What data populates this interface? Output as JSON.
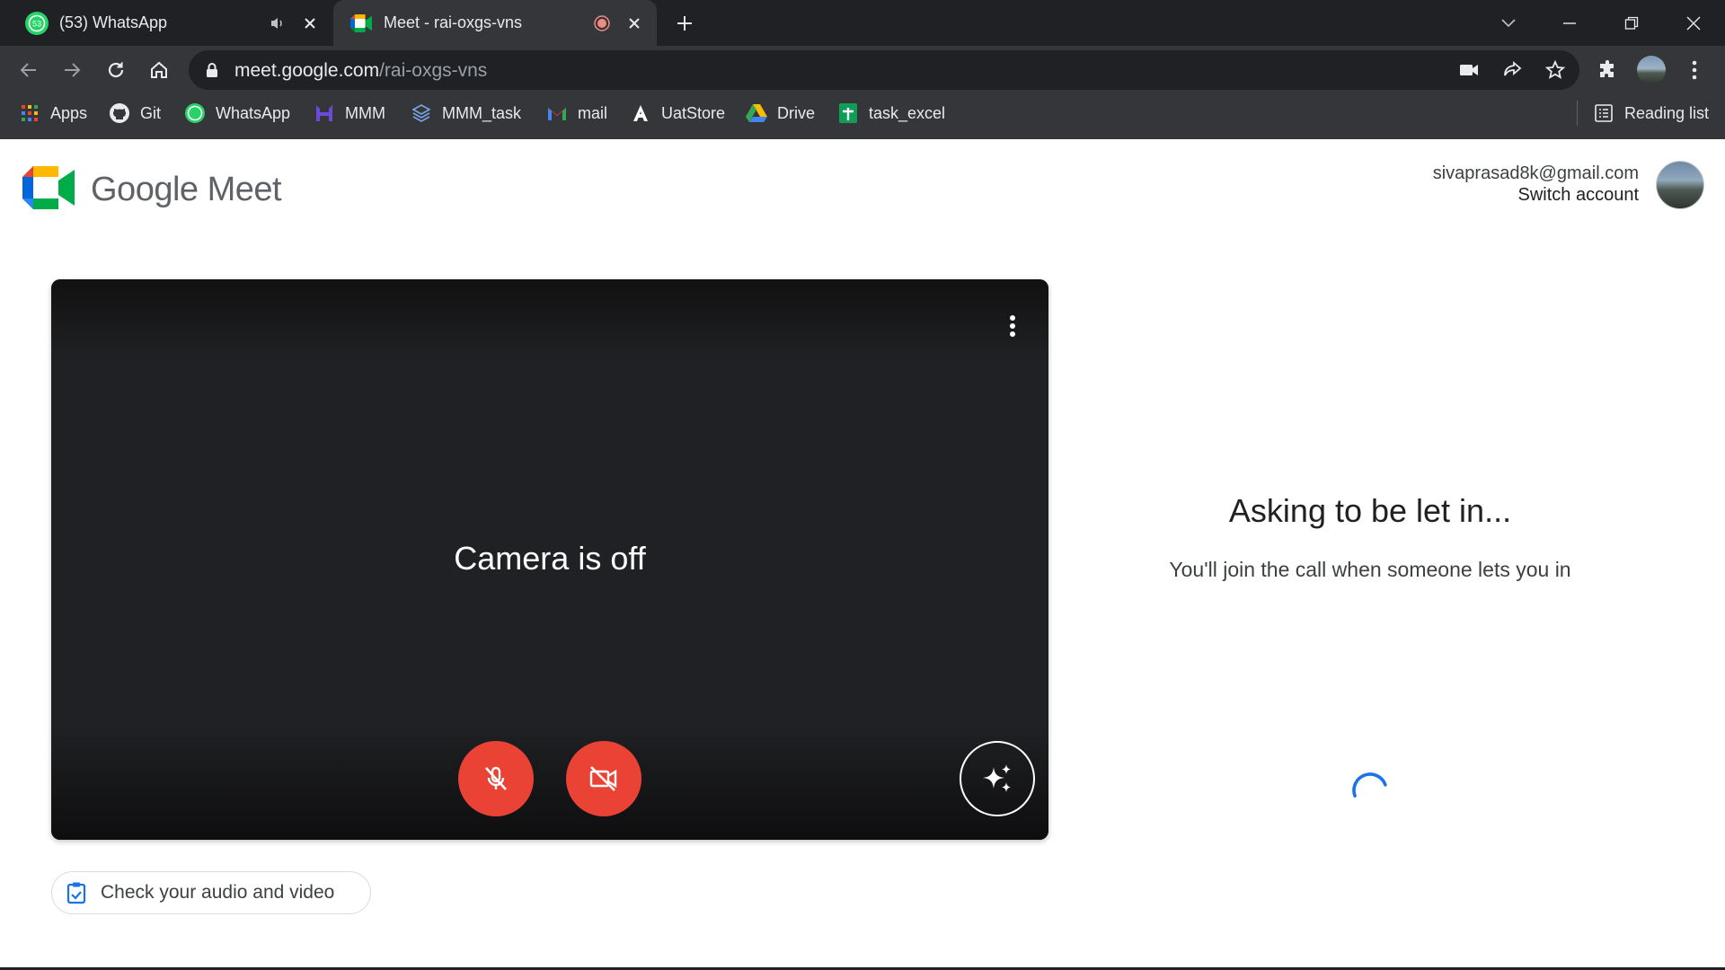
{
  "browser": {
    "tabs": [
      {
        "title": "(53) WhatsApp",
        "badge": "53",
        "active": false
      },
      {
        "title": "Meet - rai-oxgs-vns",
        "active": true
      }
    ],
    "url_host": "meet.google.com",
    "url_path": "/rai-oxgs-vns",
    "bookmarks": [
      {
        "label": "Apps",
        "icon": "apps-grid-icon"
      },
      {
        "label": "Git",
        "icon": "github-icon"
      },
      {
        "label": "WhatsApp",
        "icon": "whatsapp-icon"
      },
      {
        "label": "MMM",
        "icon": "mmm-icon"
      },
      {
        "label": "MMM_task",
        "icon": "mmm-task-icon"
      },
      {
        "label": "mail",
        "icon": "gmail-icon"
      },
      {
        "label": "UatStore",
        "icon": "uatstore-icon"
      },
      {
        "label": "Drive",
        "icon": "drive-icon"
      },
      {
        "label": "task_excel",
        "icon": "sheets-icon"
      }
    ],
    "reading_list": "Reading list"
  },
  "meet": {
    "brand": "Google Meet",
    "account_email": "sivaprasad8k@gmail.com",
    "switch_account": "Switch account",
    "camera_status": "Camera is off",
    "check_audio_video": "Check your audio and video",
    "asking_title": "Asking to be let in...",
    "asking_sub": "You'll join the call when someone lets you in"
  },
  "colors": {
    "chrome_dark": "#202124",
    "chrome_toolbar": "#35363a",
    "danger_red": "#ea4335",
    "meet_blue": "#1a73e8"
  }
}
